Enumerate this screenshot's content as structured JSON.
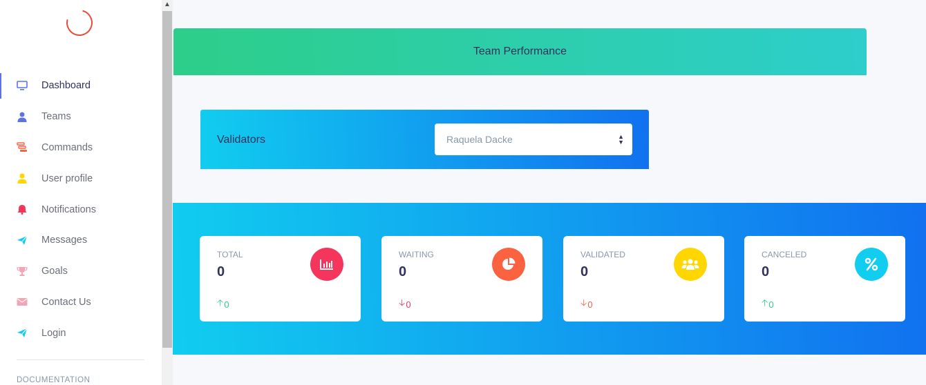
{
  "sidebar": {
    "items": [
      {
        "label": "Dashboard",
        "icon": "monitor-icon"
      },
      {
        "label": "Teams",
        "icon": "user-icon"
      },
      {
        "label": "Commands",
        "icon": "database-icon"
      },
      {
        "label": "User profile",
        "icon": "user-icon"
      },
      {
        "label": "Notifications",
        "icon": "bell-icon"
      },
      {
        "label": "Messages",
        "icon": "send-icon"
      },
      {
        "label": "Goals",
        "icon": "trophy-icon"
      },
      {
        "label": "Contact Us",
        "icon": "mail-icon"
      },
      {
        "label": "Login",
        "icon": "send-icon"
      }
    ],
    "section_label": "DOCUMENTATION"
  },
  "banner": {
    "title": "Team Performance"
  },
  "validators": {
    "label": "Validators",
    "selected": "Raquela Dacke"
  },
  "stats": [
    {
      "title": "TOTAL",
      "value": "0",
      "change": "0",
      "direction": "up",
      "icon": "chart-bar-icon",
      "color": "#f5365c"
    },
    {
      "title": "WAITING",
      "value": "0",
      "change": "0",
      "direction": "down",
      "icon": "chart-pie-icon",
      "color": "#fb6340"
    },
    {
      "title": "VALIDATED",
      "value": "0",
      "change": "0",
      "direction": "down",
      "icon": "users-icon",
      "color": "#ffd600"
    },
    {
      "title": "CANCELED",
      "value": "0",
      "change": "0",
      "direction": "up",
      "icon": "percent-icon",
      "color": "#11cdef"
    }
  ],
  "colors": {
    "accent": "#5e72e4",
    "success": "#2dce89",
    "danger": "#f5365c",
    "warning": "#fb6340"
  }
}
